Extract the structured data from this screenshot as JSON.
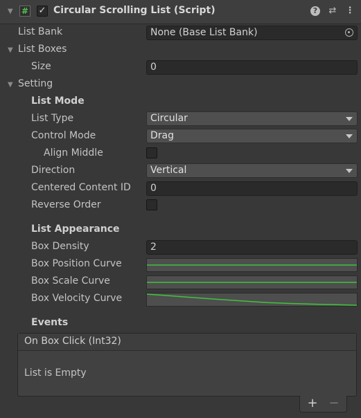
{
  "header": {
    "title": "Circular Scrolling List (Script)",
    "script_icon_glyph": "#",
    "enabled_check": "✓",
    "help_glyph": "?",
    "preset_glyph": "⇄",
    "menu_glyph": "⋮"
  },
  "fields": {
    "list_bank": {
      "label": "List Bank",
      "value": "None (Base List Bank)"
    },
    "list_boxes": {
      "label": "List Boxes"
    },
    "size": {
      "label": "Size",
      "value": "0"
    },
    "setting": {
      "label": "Setting"
    }
  },
  "list_mode": {
    "heading": "List Mode",
    "list_type": {
      "label": "List Type",
      "value": "Circular"
    },
    "control_mode": {
      "label": "Control Mode",
      "value": "Drag"
    },
    "align_middle": {
      "label": "Align Middle",
      "checked": false
    },
    "direction": {
      "label": "Direction",
      "value": "Vertical"
    },
    "centered_content_id": {
      "label": "Centered Content ID",
      "value": "0"
    },
    "reverse_order": {
      "label": "Reverse Order",
      "checked": false
    }
  },
  "list_appearance": {
    "heading": "List Appearance",
    "box_density": {
      "label": "Box Density",
      "value": "2"
    },
    "box_position_curve": {
      "label": "Box Position Curve"
    },
    "box_scale_curve": {
      "label": "Box Scale Curve"
    },
    "box_velocity_curve": {
      "label": "Box Velocity Curve"
    },
    "curve_color": "#3fc43a"
  },
  "events": {
    "heading": "Events",
    "on_box_click": "On Box Click (Int32)",
    "empty_text": "List is Empty",
    "add_glyph": "+",
    "remove_glyph": "−"
  }
}
